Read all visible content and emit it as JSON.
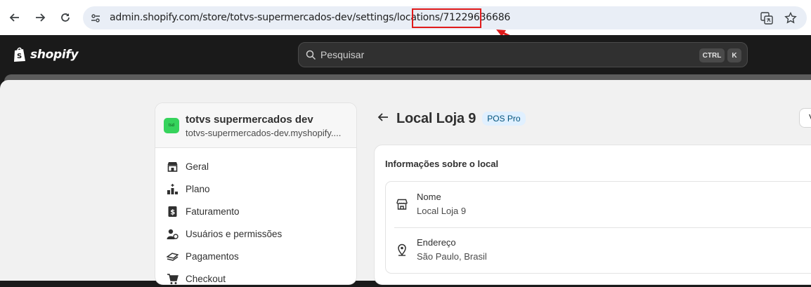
{
  "browser": {
    "url_prefix": "admin.shopify.com/store/totvs-supermercados-dev/settings/locations/",
    "url_id": "71229636686"
  },
  "shopify": {
    "logo_text": "shopify",
    "search_placeholder": "Pesquisar",
    "shortcut_keys": [
      "CTRL",
      "K"
    ]
  },
  "sidebar": {
    "store_avatar": "tsd",
    "store_name": "totvs supermercados dev",
    "store_domain": "totvs-supermercados-dev.myshopify....",
    "items": [
      {
        "label": "Geral",
        "icon": "store-icon"
      },
      {
        "label": "Plano",
        "icon": "plan-icon"
      },
      {
        "label": "Faturamento",
        "icon": "billing-icon"
      },
      {
        "label": "Usuários e permissões",
        "icon": "users-icon"
      },
      {
        "label": "Pagamentos",
        "icon": "payments-icon"
      },
      {
        "label": "Checkout",
        "icon": "cart-icon"
      }
    ]
  },
  "page": {
    "title": "Local Loja 9",
    "badge": "POS Pro",
    "top_right_button": "V"
  },
  "card": {
    "title": "Informações sobre o local",
    "fields": [
      {
        "label": "Nome",
        "value": "Local Loja 9",
        "icon": "store-icon"
      },
      {
        "label": "Endereço",
        "value": "São Paulo, Brasil",
        "icon": "location-pin-icon"
      }
    ]
  },
  "colors": {
    "annotation": "#e01b1b",
    "badge_bg": "#e0f0ff",
    "avatar_bg": "#36d35c"
  }
}
